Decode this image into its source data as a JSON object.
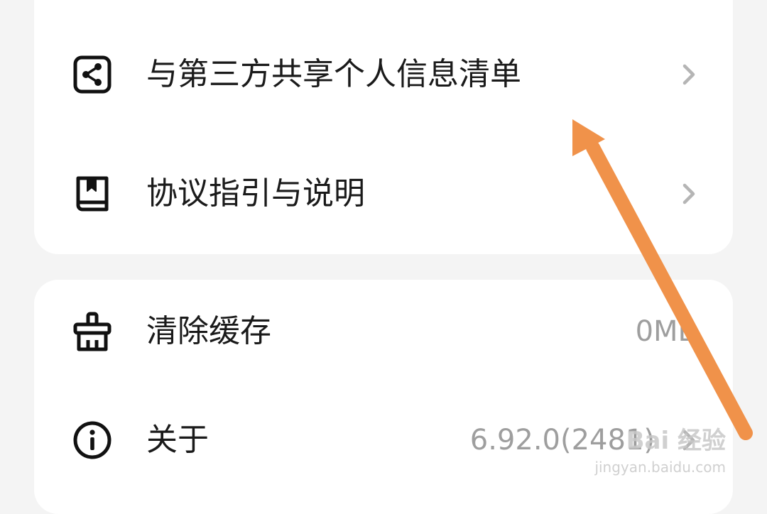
{
  "sections": [
    {
      "items": [
        {
          "label": "与第三方共享个人信息清单",
          "icon": "share-icon",
          "value": "",
          "has_chevron": true
        },
        {
          "label": "协议指引与说明",
          "icon": "book-icon",
          "value": "",
          "has_chevron": true
        }
      ]
    },
    {
      "items": [
        {
          "label": "清除缓存",
          "icon": "broom-icon",
          "value": "0MB",
          "has_chevron": false
        },
        {
          "label": "关于",
          "icon": "info-icon",
          "value": "6.92.0(2481)",
          "has_chevron": true
        }
      ]
    }
  ],
  "annotation": {
    "arrow_color": "#f0924a",
    "points_to": "与第三方共享个人信息清单"
  },
  "watermark": {
    "brand": "Bai 经验",
    "url": "jingyan.baidu.com"
  },
  "colors": {
    "background": "#f4f4f4",
    "card": "#ffffff",
    "text": "#1a1a1a",
    "secondary_text": "#9e9e9e",
    "chevron": "#b5b5b5"
  }
}
